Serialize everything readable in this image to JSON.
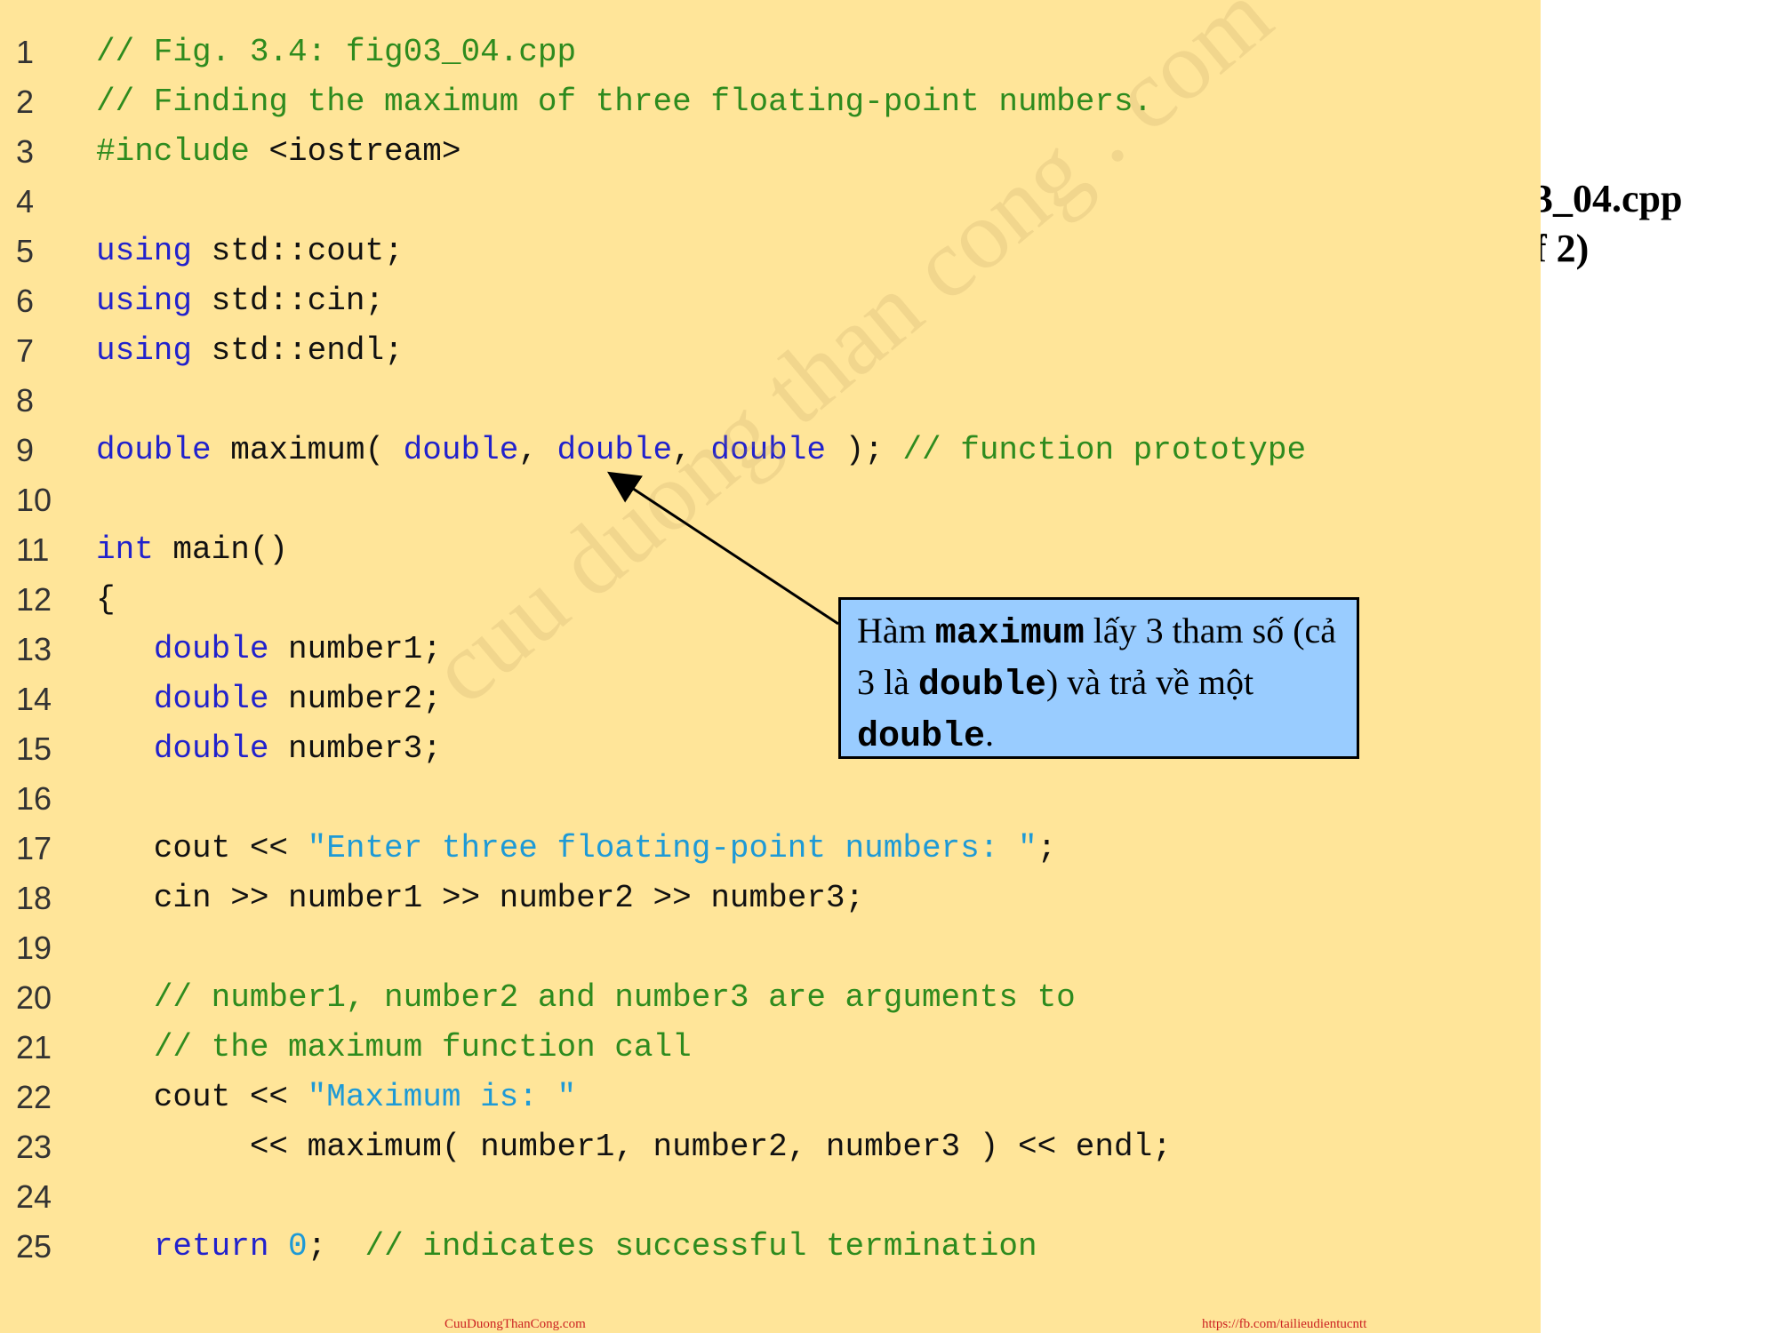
{
  "side_title": {
    "line1": "3_04.cpp",
    "line2": "f 2)"
  },
  "lines": [
    {
      "n": "1",
      "segs": [
        {
          "t": "// Fig. 3.4: fig03_04.cpp",
          "c": "cm"
        }
      ]
    },
    {
      "n": "2",
      "segs": [
        {
          "t": "// Finding the maximum of three floating-point numbers.",
          "c": "cm"
        }
      ]
    },
    {
      "n": "3",
      "segs": [
        {
          "t": "#include",
          "c": "pre"
        },
        {
          "t": " <iostream>",
          "c": ""
        }
      ]
    },
    {
      "n": "4",
      "segs": []
    },
    {
      "n": "5",
      "segs": [
        {
          "t": "using",
          "c": "kw"
        },
        {
          "t": " std::cout;",
          "c": ""
        }
      ]
    },
    {
      "n": "6",
      "segs": [
        {
          "t": "using",
          "c": "kw"
        },
        {
          "t": " std::cin;",
          "c": ""
        }
      ]
    },
    {
      "n": "7",
      "segs": [
        {
          "t": "using",
          "c": "kw"
        },
        {
          "t": " std::endl;",
          "c": ""
        }
      ]
    },
    {
      "n": "8",
      "segs": []
    },
    {
      "n": "9",
      "segs": [
        {
          "t": "double",
          "c": "kw"
        },
        {
          "t": " maximum( ",
          "c": ""
        },
        {
          "t": "double",
          "c": "kw"
        },
        {
          "t": ", ",
          "c": ""
        },
        {
          "t": "double",
          "c": "kw"
        },
        {
          "t": ", ",
          "c": ""
        },
        {
          "t": "double",
          "c": "kw"
        },
        {
          "t": " ); ",
          "c": ""
        },
        {
          "t": "// function prototype",
          "c": "cm"
        }
      ]
    },
    {
      "n": "10",
      "segs": []
    },
    {
      "n": "11",
      "segs": [
        {
          "t": "int",
          "c": "kw"
        },
        {
          "t": " main()",
          "c": ""
        }
      ]
    },
    {
      "n": "12",
      "segs": [
        {
          "t": "{",
          "c": ""
        }
      ]
    },
    {
      "n": "13",
      "segs": [
        {
          "t": "   ",
          "c": ""
        },
        {
          "t": "double",
          "c": "kw"
        },
        {
          "t": " number1;",
          "c": ""
        }
      ]
    },
    {
      "n": "14",
      "segs": [
        {
          "t": "   ",
          "c": ""
        },
        {
          "t": "double",
          "c": "kw"
        },
        {
          "t": " number2;",
          "c": ""
        }
      ]
    },
    {
      "n": "15",
      "segs": [
        {
          "t": "   ",
          "c": ""
        },
        {
          "t": "double",
          "c": "kw"
        },
        {
          "t": " number3;",
          "c": ""
        }
      ]
    },
    {
      "n": "16",
      "segs": []
    },
    {
      "n": "17",
      "segs": [
        {
          "t": "   cout << ",
          "c": ""
        },
        {
          "t": "\"Enter three floating-point numbers: \"",
          "c": "st"
        },
        {
          "t": ";",
          "c": ""
        }
      ]
    },
    {
      "n": "18",
      "segs": [
        {
          "t": "   cin >> number1 >> number2 >> number3;",
          "c": ""
        }
      ]
    },
    {
      "n": "19",
      "segs": []
    },
    {
      "n": "20",
      "segs": [
        {
          "t": "   ",
          "c": ""
        },
        {
          "t": "// number1, number2 and number3 are arguments to",
          "c": "cm"
        }
      ]
    },
    {
      "n": "21",
      "segs": [
        {
          "t": "   ",
          "c": ""
        },
        {
          "t": "// the maximum function call",
          "c": "cm"
        }
      ]
    },
    {
      "n": "22",
      "segs": [
        {
          "t": "   cout << ",
          "c": ""
        },
        {
          "t": "\"Maximum is: \"",
          "c": "st"
        }
      ]
    },
    {
      "n": "23",
      "segs": [
        {
          "t": "        << maximum( number1, number2, number3 ) << endl;",
          "c": ""
        }
      ]
    },
    {
      "n": "24",
      "segs": []
    },
    {
      "n": "25",
      "segs": [
        {
          "t": "   ",
          "c": ""
        },
        {
          "t": "return",
          "c": "kw"
        },
        {
          "t": " ",
          "c": ""
        },
        {
          "t": "0",
          "c": "num"
        },
        {
          "t": ";  ",
          "c": ""
        },
        {
          "t": "// indicates successful termination",
          "c": "cm"
        }
      ]
    }
  ],
  "callout": {
    "p1": "Hàm ",
    "m1": "maximum",
    "p2": " lấy 3 tham số (cả 3 là ",
    "m2": "double",
    "p3": ") và trả về một ",
    "m3": "double",
    "p4": "."
  },
  "watermark": "cuu duong than cong . com",
  "footer": {
    "left": "CuuDuongThanCong.com",
    "right": "https://fb.com/tailieudientucntt"
  },
  "colors": {
    "panel_bg": "#ffe599",
    "keyword": "#2222cc",
    "comment": "#2e8b1e",
    "string": "#1e9ad6",
    "callout_bg": "#99ccff"
  }
}
